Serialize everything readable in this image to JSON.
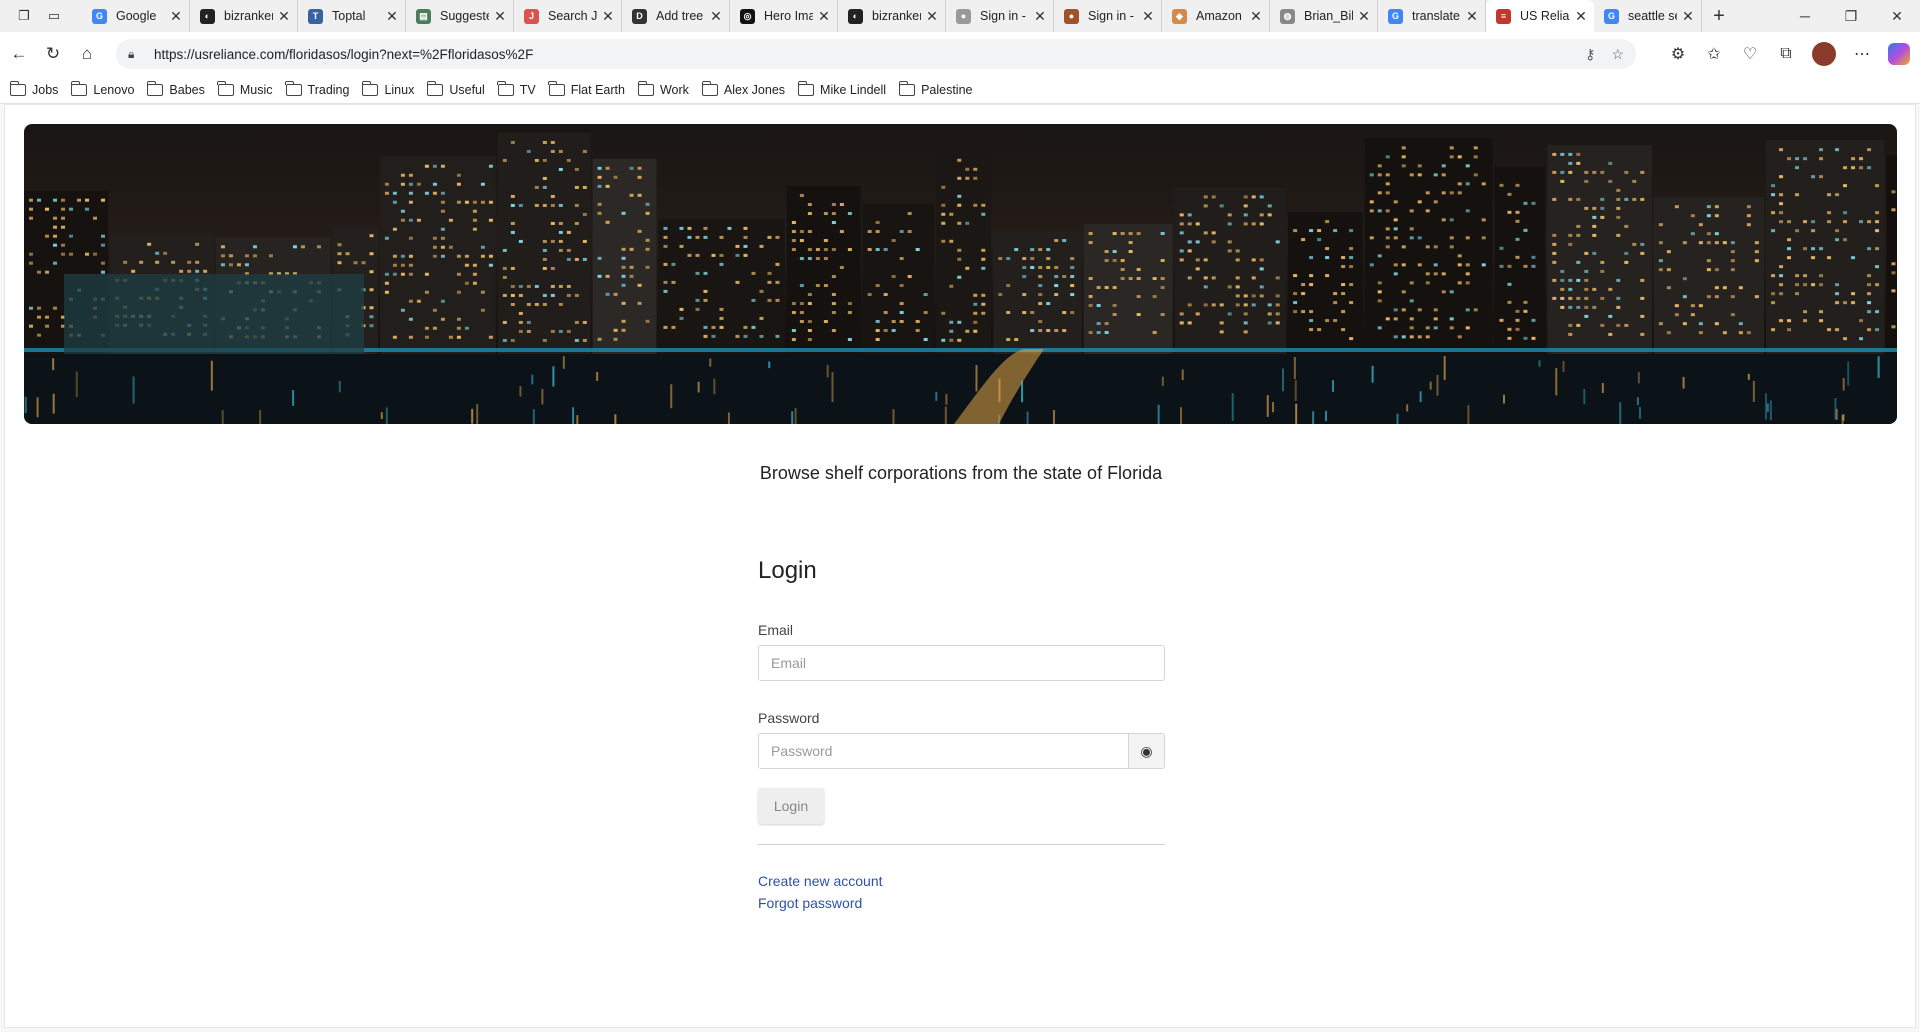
{
  "browser": {
    "tabs": [
      {
        "title": "Google",
        "icon": "google-icon",
        "color": "#4285f4",
        "glyph": "G"
      },
      {
        "title": "bizranker",
        "icon": "github-icon",
        "color": "#222222",
        "glyph": "◐"
      },
      {
        "title": "Toptal",
        "icon": "toptal-icon",
        "color": "#3863a0",
        "glyph": "T"
      },
      {
        "title": "Suggeste",
        "icon": "document-icon",
        "color": "#4a7c59",
        "glyph": "▤"
      },
      {
        "title": "Search Jc",
        "icon": "search-job-icon",
        "color": "#d9534f",
        "glyph": "J"
      },
      {
        "title": "Add tree",
        "icon": "dev-icon",
        "color": "#333333",
        "glyph": "D"
      },
      {
        "title": "Hero Ima",
        "icon": "hero-icon",
        "color": "#111111",
        "glyph": "◎"
      },
      {
        "title": "bizranker",
        "icon": "github-icon",
        "color": "#222222",
        "glyph": "◐"
      },
      {
        "title": "Sign in -",
        "icon": "avatar-icon",
        "color": "#999999",
        "glyph": "●"
      },
      {
        "title": "Sign in -",
        "icon": "avatar-icon",
        "color": "#a0522d",
        "glyph": "●"
      },
      {
        "title": "Amazon",
        "icon": "amazon-icon",
        "color": "#d48a4a",
        "glyph": "◆"
      },
      {
        "title": "Brian_Bil",
        "icon": "globe-icon",
        "color": "#888888",
        "glyph": "◍"
      },
      {
        "title": "translate",
        "icon": "google-icon",
        "color": "#4285f4",
        "glyph": "G"
      },
      {
        "title": "US Relian",
        "icon": "us-flag-icon",
        "color": "#c0392b",
        "glyph": "≡",
        "active": true
      },
      {
        "title": "seattle se",
        "icon": "google-icon",
        "color": "#4285f4",
        "glyph": "G"
      }
    ],
    "url": "https://usreliance.com/floridasos/login?next=%2Ffloridasos%2F",
    "bookmarks": [
      "Jobs",
      "Lenovo",
      "Babes",
      "Music",
      "Trading",
      "Linux",
      "Useful",
      "TV",
      "Flat Earth",
      "Work",
      "Alex Jones",
      "Mike Lindell",
      "Palestine"
    ]
  },
  "page": {
    "tagline": "Browse shelf corporations from the state of Florida",
    "login": {
      "heading": "Login",
      "email_label": "Email",
      "email_placeholder": "Email",
      "password_label": "Password",
      "password_placeholder": "Password",
      "submit_label": "Login",
      "create_account_link": "Create new account",
      "forgot_password_link": "Forgot password"
    }
  }
}
